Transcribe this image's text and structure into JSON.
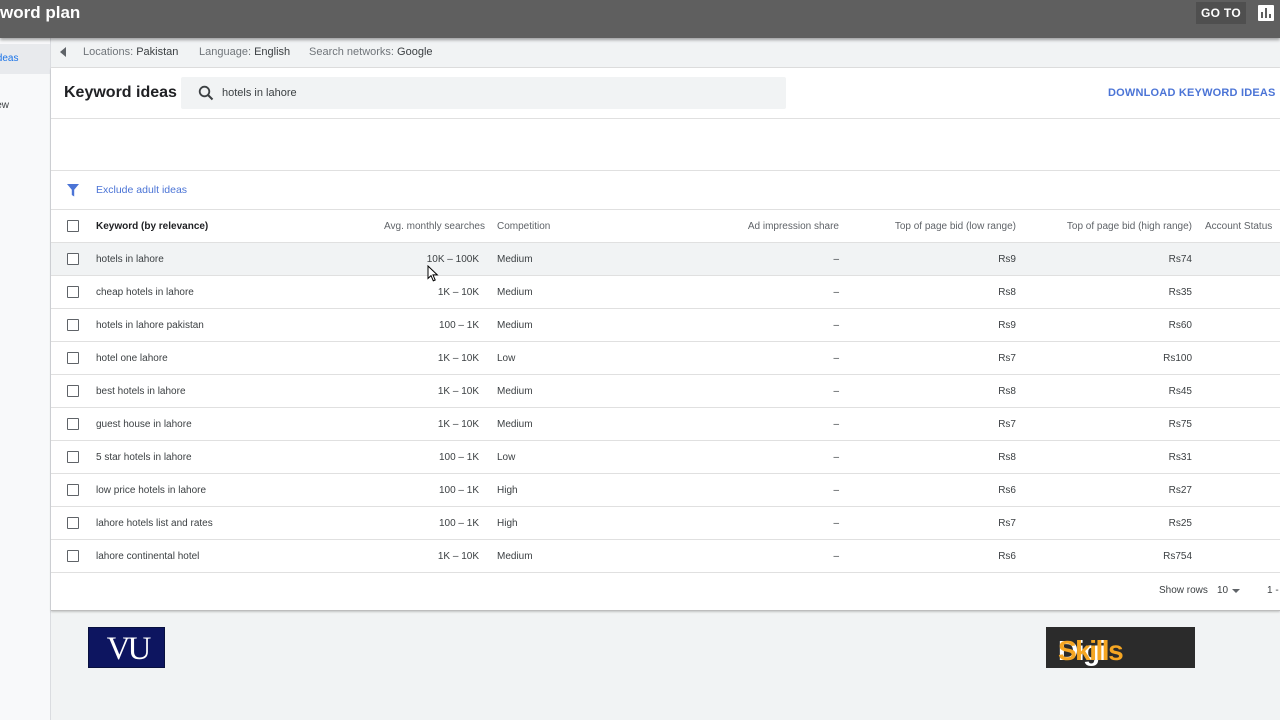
{
  "app": {
    "title": "word plan",
    "goto_label": "GO TO",
    "chart_icon": "bar-chart-icon"
  },
  "nav": {
    "ideas_label": "Ideas",
    "overview_label": "view"
  },
  "filters": {
    "locations_label": "Locations:",
    "locations_value": "Pakistan",
    "language_label": "Language:",
    "language_value": "English",
    "networks_label": "Search networks:",
    "networks_value": "Google"
  },
  "header": {
    "title": "Keyword ideas",
    "search_value": "hotels in lahore",
    "download_label": "DOWNLOAD KEYWORD IDEAS"
  },
  "exclude": {
    "label": "Exclude adult ideas"
  },
  "columns": {
    "keyword": "Keyword (by relevance)",
    "avg_searches": "Avg. monthly searches",
    "competition": "Competition",
    "ad_impression": "Ad impression share",
    "bid_low": "Top of page bid (low range)",
    "bid_high": "Top of page bid (high range)",
    "account_status": "Account Status"
  },
  "rows": [
    {
      "keyword": "hotels in lahore",
      "avg": "10K – 100K",
      "competition": "Medium",
      "impression": "–",
      "low": "Rs9",
      "high": "Rs74"
    },
    {
      "keyword": "cheap hotels in lahore",
      "avg": "1K – 10K",
      "competition": "Medium",
      "impression": "–",
      "low": "Rs8",
      "high": "Rs35"
    },
    {
      "keyword": "hotels in lahore pakistan",
      "avg": "100 – 1K",
      "competition": "Medium",
      "impression": "–",
      "low": "Rs9",
      "high": "Rs60"
    },
    {
      "keyword": "hotel one lahore",
      "avg": "1K – 10K",
      "competition": "Low",
      "impression": "–",
      "low": "Rs7",
      "high": "Rs100"
    },
    {
      "keyword": "best hotels in lahore",
      "avg": "1K – 10K",
      "competition": "Medium",
      "impression": "–",
      "low": "Rs8",
      "high": "Rs45"
    },
    {
      "keyword": "guest house in lahore",
      "avg": "1K – 10K",
      "competition": "Medium",
      "impression": "–",
      "low": "Rs7",
      "high": "Rs75"
    },
    {
      "keyword": "5 star hotels in lahore",
      "avg": "100 – 1K",
      "competition": "Low",
      "impression": "–",
      "low": "Rs8",
      "high": "Rs31"
    },
    {
      "keyword": "low price hotels in lahore",
      "avg": "100 – 1K",
      "competition": "High",
      "impression": "–",
      "low": "Rs6",
      "high": "Rs27"
    },
    {
      "keyword": "lahore hotels list and rates",
      "avg": "100 – 1K",
      "competition": "High",
      "impression": "–",
      "low": "Rs7",
      "high": "Rs25"
    },
    {
      "keyword": "lahore continental hotel",
      "avg": "1K – 10K",
      "competition": "Medium",
      "impression": "–",
      "low": "Rs6",
      "high": "Rs754"
    }
  ],
  "pagination": {
    "show_rows_label": "Show rows",
    "rows_value": "10",
    "range": "1 -"
  },
  "logos": {
    "vu": "VU",
    "digi": "Digi",
    "skills": "Skills"
  }
}
